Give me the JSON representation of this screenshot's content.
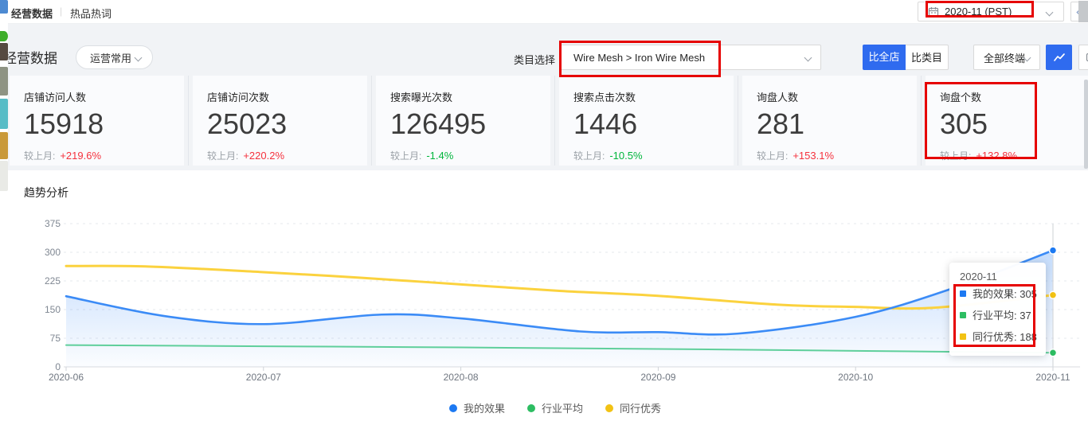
{
  "topbar": {
    "tabs": [
      {
        "label": "经营数据",
        "active": true
      },
      {
        "label": "热品热词",
        "active": false
      }
    ],
    "tab_divider": "|",
    "date_picker": {
      "value": "2020-11 (PST)"
    }
  },
  "toolbar": {
    "section_title": "经营数据",
    "preset_select": {
      "value": "运营常用"
    },
    "category_label": "类目选择",
    "category_select": {
      "value": "Wire Mesh > Iron Wire Mesh"
    },
    "compare_buttons": [
      {
        "label": "比全店",
        "active": true
      },
      {
        "label": "比类目",
        "active": false
      }
    ],
    "terminal_select": {
      "value": "全部终端"
    }
  },
  "cards_common": {
    "mom_label": "较上月:"
  },
  "stats_cards": [
    {
      "label": "店铺访问人数",
      "value": "15918",
      "mom_value": "+219.6%",
      "direction": "up"
    },
    {
      "label": "店铺访问次数",
      "value": "25023",
      "mom_value": "+220.2%",
      "direction": "up"
    },
    {
      "label": "搜索曝光次数",
      "value": "126495",
      "mom_value": "-1.4%",
      "direction": "down"
    },
    {
      "label": "搜索点击次数",
      "value": "1446",
      "mom_value": "-10.5%",
      "direction": "down"
    },
    {
      "label": "询盘人数",
      "value": "281",
      "mom_value": "+153.1%",
      "direction": "up"
    },
    {
      "label": "询盘个数",
      "value": "305",
      "mom_value": "+132.8%",
      "direction": "up",
      "highlighted": true
    }
  ],
  "trend": {
    "title": "趋势分析"
  },
  "chart_data": {
    "type": "line",
    "x_labels": [
      "2020-06",
      "2020-07",
      "2020-08",
      "2020-09",
      "2020-10",
      "2020-11"
    ],
    "y_ticks": [
      0,
      75,
      150,
      225,
      300,
      375
    ],
    "ylim": [
      0,
      375
    ],
    "grid": "dashed-horizontal",
    "legend_position": "bottom",
    "hover_month_index": 5,
    "series": [
      {
        "name": "我的效果",
        "line_color": "#3b8bf6",
        "marker_color": "#1c79f2",
        "line_width": 2.6,
        "area": true,
        "monthly_values": [
          185,
          112,
          127,
          91,
          131,
          305
        ],
        "shape_points": [
          [
            0,
            185
          ],
          [
            0.5,
            133
          ],
          [
            1,
            112
          ],
          [
            1.6,
            137
          ],
          [
            2,
            127
          ],
          [
            2.6,
            93
          ],
          [
            3,
            91
          ],
          [
            3.4,
            87
          ],
          [
            4,
            131
          ],
          [
            4.5,
            207
          ],
          [
            5,
            305
          ]
        ]
      },
      {
        "name": "行业平均",
        "line_color": "#5fcf9b",
        "marker_color": "#2dbd62",
        "line_width": 2,
        "area": false,
        "monthly_values": [
          57,
          54,
          51,
          47,
          42,
          37
        ],
        "shape_points": [
          [
            0,
            57
          ],
          [
            1,
            54
          ],
          [
            2,
            51
          ],
          [
            3,
            47
          ],
          [
            4,
            42
          ],
          [
            5,
            37
          ]
        ]
      },
      {
        "name": "同行优秀",
        "line_color": "#fbd23e",
        "marker_color": "#f2c214",
        "line_width": 3,
        "area": false,
        "monthly_values": [
          264,
          248,
          216,
          186,
          157,
          188
        ],
        "shape_points": [
          [
            0,
            264
          ],
          [
            0.4,
            263
          ],
          [
            1,
            248
          ],
          [
            1.5,
            233
          ],
          [
            2,
            216
          ],
          [
            2.5,
            199
          ],
          [
            3,
            186
          ],
          [
            3.6,
            163
          ],
          [
            4,
            157
          ],
          [
            4.4,
            155
          ],
          [
            5,
            188
          ]
        ]
      }
    ],
    "tooltip": {
      "title": "2020-11",
      "rows": [
        {
          "series": "我的效果",
          "value": 305
        },
        {
          "series": "行业平均",
          "value": 37
        },
        {
          "series": "同行优秀",
          "value": 188
        }
      ]
    }
  },
  "colors": {
    "accent_blue": "#2f6bef",
    "annotation_red": "#e60000",
    "up_red": "#f5313d",
    "down_green": "#00b53c",
    "band_gray": "#f1f3f6"
  }
}
